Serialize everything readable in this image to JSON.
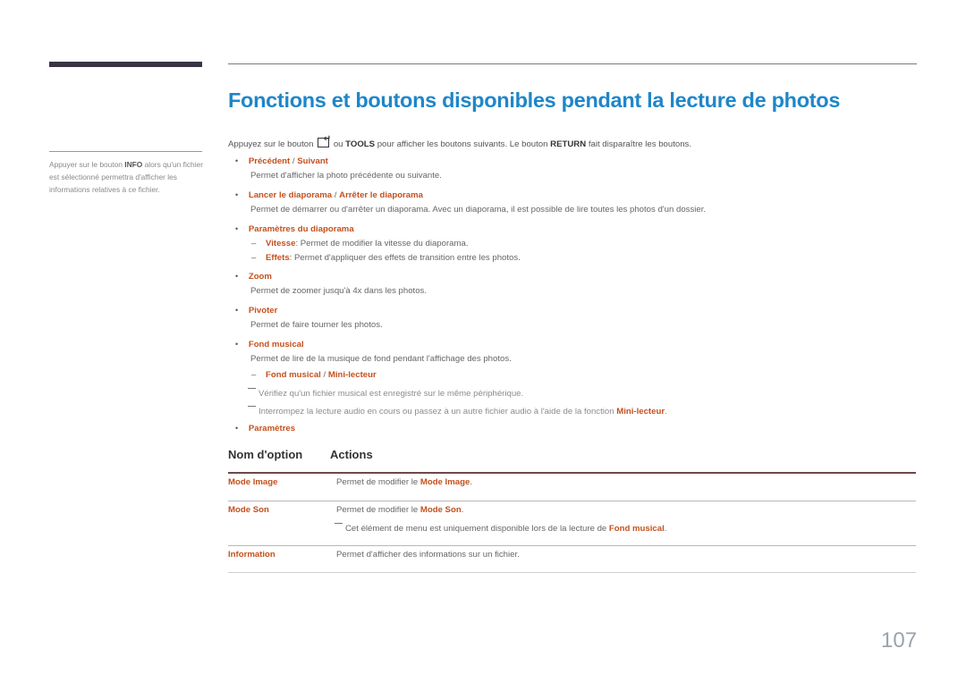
{
  "sidebar": {
    "note_part1": "Appuyer sur le bouton ",
    "note_bold": "INFO",
    "note_part2": " alors qu'un fichier est sélectionné permettra d'afficher les informations relatives à ce fichier."
  },
  "title": "Fonctions et boutons disponibles pendant la lecture de photos",
  "intro": {
    "part1": "Appuyez sur le bouton",
    "icon": "enter-icon",
    "part2": "ou",
    "tools": "TOOLS",
    "part3": "pour afficher les boutons suivants. Le bouton",
    "return": "RETURN",
    "part4": "fait disparaître les boutons."
  },
  "bullet_char": "•",
  "dash_char": "–",
  "items": {
    "prev_next": {
      "a": "Précédent",
      "sep": " / ",
      "b": "Suivant",
      "desc": "Permet d'afficher la photo précédente ou suivante."
    },
    "slideshow": {
      "a": "Lancer le diaporama",
      "sep": " / ",
      "b": "Arrêter le diaporama",
      "desc": "Permet de démarrer ou d'arrêter un diaporama. Avec un diaporama, il est possible de lire toutes les photos d'un dossier."
    },
    "slideshow_settings": {
      "label": "Paramètres du diaporama",
      "sub": [
        {
          "label": "Vitesse",
          "desc": ": Permet de modifier la vitesse du diaporama."
        },
        {
          "label": "Effets",
          "desc": ": Permet d'appliquer des effets de transition entre les photos."
        }
      ]
    },
    "zoom": {
      "label": "Zoom",
      "desc": "Permet de zoomer jusqu'à 4x dans les photos."
    },
    "rotate": {
      "label": "Pivoter",
      "desc": "Permet de faire tourner les photos."
    },
    "music": {
      "label": "Fond musical",
      "desc": "Permet de lire de la musique de fond pendant l'affichage des photos.",
      "sub_a": "Fond musical",
      "sub_sep": " / ",
      "sub_b": "Mini-lecteur",
      "note1": "Vérifiez qu'un fichier musical est enregistré sur le même périphérique.",
      "note2": "Interrompez la lecture audio en cours ou passez à un autre fichier audio à l'aide de la fonction ",
      "note2_hl": "Mini-lecteur",
      "note2_end": "."
    },
    "settings": {
      "label": "Paramètres"
    }
  },
  "table": {
    "headers": [
      "Nom d'option",
      "Actions"
    ],
    "rows": [
      {
        "name": "Mode Image",
        "desc": "Permet de modifier le ",
        "desc_hl": "Mode Image",
        "desc_end": "."
      },
      {
        "name": "Mode Son",
        "desc": "Permet de modifier le ",
        "desc_hl": "Mode Son",
        "desc_end": ".",
        "note": "Cet élément de menu est uniquement disponible lors de la lecture de ",
        "note_hl": "Fond musical",
        "note_end": "."
      },
      {
        "name": "Information",
        "desc": "Permet d'afficher des informations sur un fichier."
      }
    ]
  },
  "page_number": "107"
}
